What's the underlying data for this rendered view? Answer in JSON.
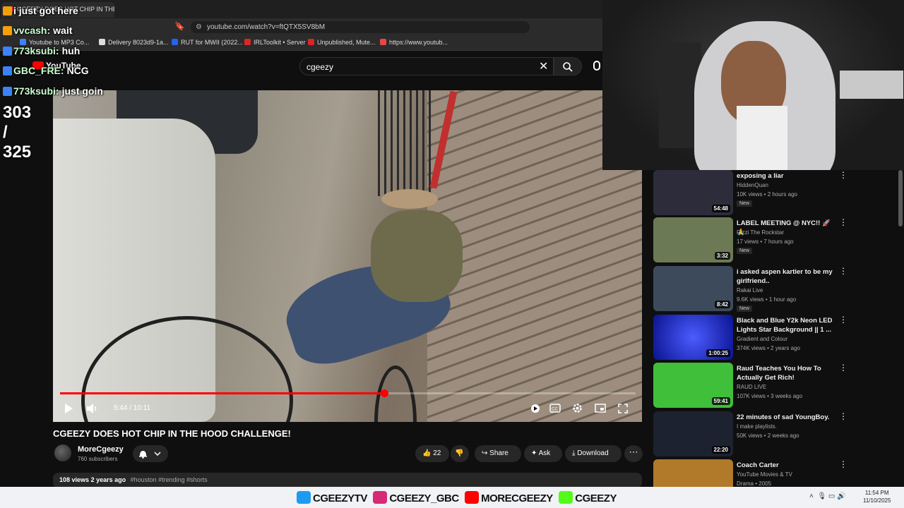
{
  "browser": {
    "tab_title": "CGEEZY DOES HOT CHIP IN THE...",
    "url": "youtube.com/watch?v=ftQTX5SV8bM",
    "bookmarks": [
      {
        "label": "Youtube to MP3 Co...",
        "color": "#3b82f6"
      },
      {
        "label": "Delivery 8023d9-1a...",
        "color": "#dddddd"
      },
      {
        "label": "RUT for MWII (2022...",
        "color": "#2563eb"
      },
      {
        "label": "IRLToolkit • Server",
        "color": "#dc2626"
      },
      {
        "label": "Unpublished, Mute...",
        "color": "#dc2626"
      },
      {
        "label": "https://www.youtub...",
        "color": "#ef4444"
      }
    ]
  },
  "youtube": {
    "logo": "YouTube",
    "search_value": "cgeezy"
  },
  "chat": {
    "lines": [
      {
        "user": "",
        "message": "i just got here",
        "badge": "#f59e0b"
      },
      {
        "user": "vvcash:",
        "message": "wait",
        "badge": "#f59e0b"
      },
      {
        "user": "773ksubi:",
        "message": "huh",
        "badge": "#3b82f6"
      },
      {
        "user": "GBC_FRE:",
        "message": "NCG",
        "badge": "#3b82f6"
      },
      {
        "user": "773ksubi:",
        "message": "just goin",
        "badge": "#3b82f6"
      }
    ],
    "counter": "303 / 325"
  },
  "video": {
    "time": "5:44 / 10:11",
    "progress": 0.563,
    "title": "CGEEZY DOES HOT CHIP IN THE HOOD CHALLENGE!",
    "channel": "MoreCgeezy",
    "subscribers": "760 subscribers",
    "likes": "22",
    "share_label": "Share",
    "ask_label": "Ask",
    "download_label": "Download",
    "views": "108 views",
    "age": "2 years ago",
    "tags": "#houston #trending #shorts"
  },
  "recommendations": [
    {
      "title": "exposing a liar",
      "channel": "HiddenQuan",
      "meta": "10K views • 2 hours ago",
      "badge": "New",
      "duration": "54:48",
      "thumb": "#2c2c3a"
    },
    {
      "title": "LABEL MEETING @ NYC!! 🚀🙏",
      "channel": "Rizzi The Rockstar",
      "meta": "17 views • 7 hours ago",
      "badge": "New",
      "duration": "3:32",
      "thumb": "#6b7a55"
    },
    {
      "title": "i asked aspen kartier to be my girlfriend..",
      "channel": "Rakai Live",
      "meta": "9.6K views • 1 hour ago",
      "badge": "New",
      "duration": "8:42",
      "thumb": "#3d4a5c"
    },
    {
      "title": "Black and Blue Y2k Neon LED Lights Star Background || 1 ...",
      "channel": "Gradient and Colour",
      "meta": "374K views • 2 years ago",
      "badge": "",
      "duration": "1:00:25",
      "thumb": "#1a2bd8"
    },
    {
      "title": "Raud Teaches You How To Actually Get Rich!",
      "channel": "RAUD LIVE",
      "meta": "107K views • 3 weeks ago",
      "badge": "",
      "duration": "59:41",
      "thumb": "#3fbf3a"
    },
    {
      "title": "22 minutes of sad YoungBoy.",
      "channel": "I make playlists.",
      "meta": "50K views • 2 weeks ago",
      "badge": "",
      "duration": "22:20",
      "thumb": "#1c2230"
    },
    {
      "title": "Coach Carter",
      "channel": "YouTube Movies & TV",
      "meta": "Drama • 2005",
      "badge": "",
      "duration": "",
      "thumb": "#b07a2a"
    }
  ],
  "taskbar": {
    "socials": [
      {
        "label": "CGEEZYTV",
        "color": "#1d9bf0"
      },
      {
        "label": "CGEEZY_GBC",
        "color": "#d62976"
      },
      {
        "label": "MORECGEEZY",
        "color": "#ff0000"
      },
      {
        "label": "CGEEZY",
        "color": "#53fc18"
      }
    ],
    "time": "11:54 PM",
    "date": "11/10/2025"
  },
  "icons": [
    "search-icon",
    "close-icon",
    "mic-icon",
    "play-icon",
    "volume-icon",
    "settings-icon",
    "captions-icon",
    "fullscreen-icon",
    "like-icon",
    "dislike-icon",
    "share-icon",
    "download-icon",
    "bell-icon"
  ]
}
